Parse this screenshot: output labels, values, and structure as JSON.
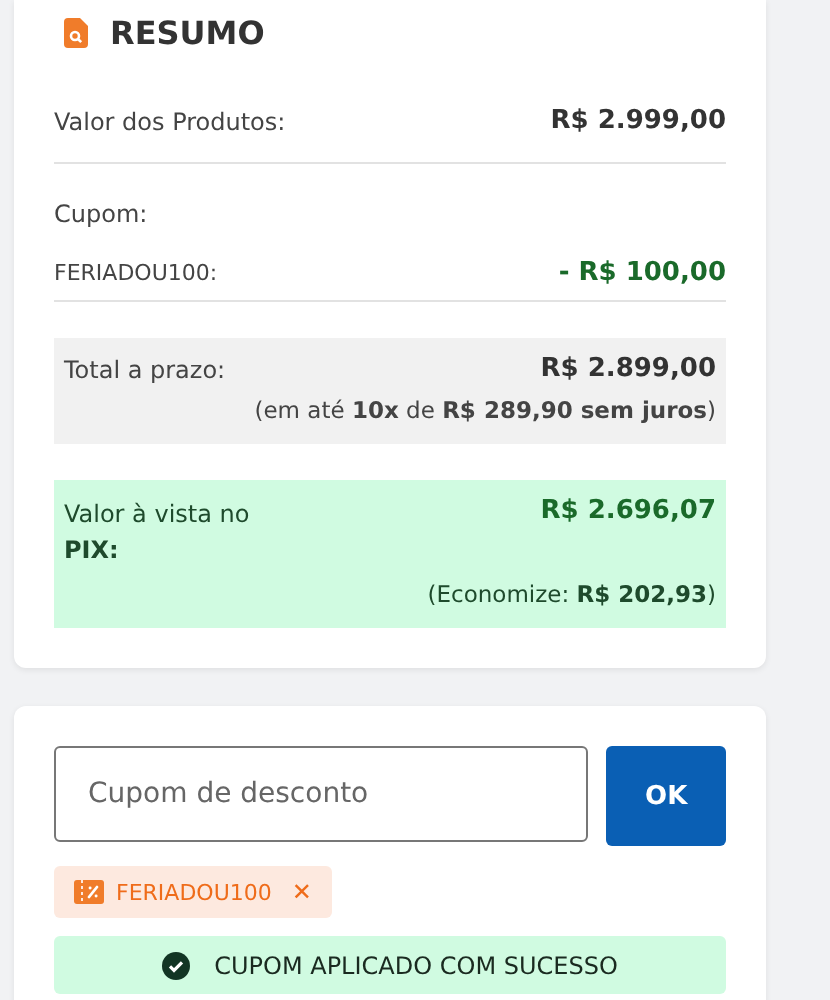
{
  "summary": {
    "title": "RESUMO",
    "products": {
      "label": "Valor dos Produtos:",
      "value": "R$ 2.999,00"
    },
    "coupon": {
      "label": "Cupom:",
      "code": "FERIADOU100:",
      "value": "- R$ 100,00"
    },
    "installment": {
      "label": "Total a prazo:",
      "value": "R$ 2.899,00",
      "note": "(em até **10x** de **R$ 289,90 sem juros**)"
    },
    "pix": {
      "label": "Valor à vista no **PIX:**",
      "value": "R$ 2.696,07",
      "note": "(Economize: **R$ 202,93**)"
    }
  },
  "coupon_form": {
    "placeholder": "Cupom de desconto",
    "button": "OK",
    "applied": [
      {
        "code": "FERIADOU100",
        "remove": "✕"
      }
    ],
    "message": {
      "kind": "success",
      "text": "CUPOM APLICADO COM SUCESSO"
    }
  }
}
